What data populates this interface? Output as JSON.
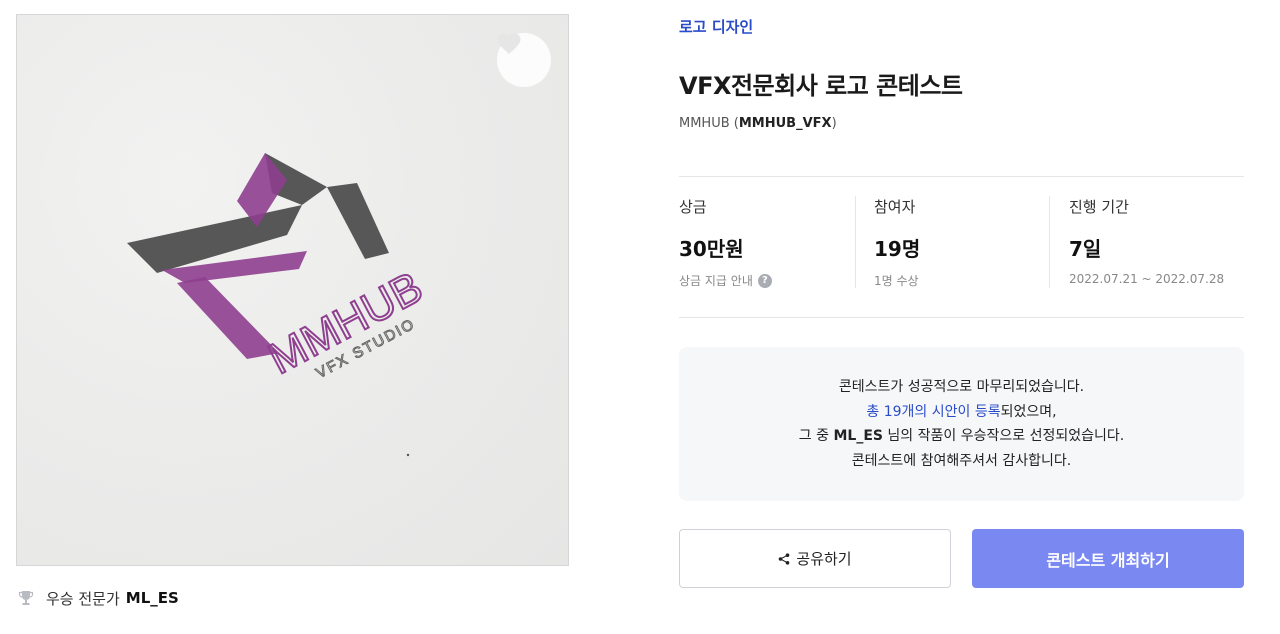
{
  "artwork": {
    "logo_wordmark": "MMHUB",
    "logo_tagline": "VFX STUDIO",
    "colors": {
      "purple": "#8e3f8f",
      "dark": "#4a4a4a",
      "paper": "#ececeb"
    }
  },
  "like": {
    "icon": "heart-icon"
  },
  "winner": {
    "label": "우승 전문가",
    "name": "ML_ES",
    "icon": "trophy-icon"
  },
  "contest": {
    "category": "로고 디자인",
    "title": "VFX전문회사 로고 콘테스트",
    "host_name": "MMHUB",
    "host_id": "MMHUB_VFX"
  },
  "stats": {
    "prize": {
      "label": "상금",
      "value": "30만원",
      "sub": "상금 지급 안내",
      "help_icon": "?"
    },
    "participants": {
      "label": "참여자",
      "value": "19명",
      "sub": "1명 수상"
    },
    "period": {
      "label": "진행 기간",
      "value": "7일",
      "sub": "2022.07.21 ~ 2022.07.28"
    }
  },
  "notice": {
    "line1": "콘테스트가 성공적으로 마무리되었습니다.",
    "line2_highlight": "총 19개의 시안이 등록",
    "line2_rest": "되었으며,",
    "line3_prefix": "그 중 ",
    "line3_name": "ML_ES",
    "line3_rest": " 님의 작품이 우승작으로 선정되었습니다.",
    "line4": "콘테스트에 참여해주셔서 감사합니다."
  },
  "buttons": {
    "share_label": "공유하기",
    "host_label": "콘테스트 개최하기"
  },
  "theme": {
    "accent": "#2b4cc9",
    "button_primary": "#7a88f2"
  }
}
